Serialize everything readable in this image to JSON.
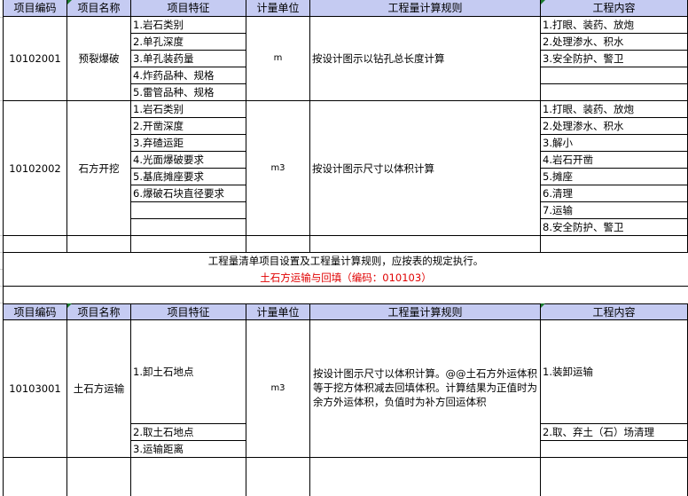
{
  "headers": [
    "项目编码",
    "项目名称",
    "项目特征",
    "计量单位",
    "工程量计算规则",
    "工程内容"
  ],
  "section1": {
    "rows": [
      {
        "code": "10102001",
        "name": "预裂爆破",
        "features": [
          "1.岩石类别",
          "2.单孔深度",
          "3.单孔装药量",
          "4.炸药品种、规格",
          "5.雷管品种、规格"
        ],
        "unit": "m",
        "rule": "按设计图示以钻孔总长度计算",
        "content": [
          "1.打眼、装药、放炮",
          "2.处理渗水、积水",
          "3.安全防护、警卫",
          ""
        ]
      },
      {
        "code": "10102002",
        "name": "石方开挖",
        "features": [
          "1.岩石类别",
          "2.开凿深度",
          "3.弃碴运距",
          "4.光面爆破要求",
          "5.基底摊座要求",
          "6.爆破石块直径要求",
          "",
          ""
        ],
        "unit": "m3",
        "rule": "按设计图示尺寸以体积计算",
        "content": [
          "1.打眼、装药、放炮",
          "2.处理渗水、积水",
          "3.解小",
          "4.岩石开凿",
          "5.摊座",
          "6.清理",
          "7.运输",
          "8.安全防护、警卫"
        ]
      }
    ]
  },
  "note": "工程量清单项目设置及工程量计算规则，应按表的规定执行。",
  "section2_title": "土石方运输与回填（编码：010103）",
  "section2": {
    "code": "10103001",
    "name": "土石方运输",
    "features": [
      "1.卸土石地点",
      "2.取土石地点",
      "3.运输距离"
    ],
    "unit": "m3",
    "rule": "按设计图示尺寸以体积计算。@@土石方外运体积等于挖方体积减去回填体积。计算结果为正值时为余方外运体积，负值时为补方回运体积",
    "content": [
      "1.装卸运输",
      "2.取、弃土（石）场清理"
    ]
  },
  "colors": {
    "header_bg": "#c5cbf2",
    "title_red": "#e00000",
    "comment_marker": "#1b7b2e"
  }
}
